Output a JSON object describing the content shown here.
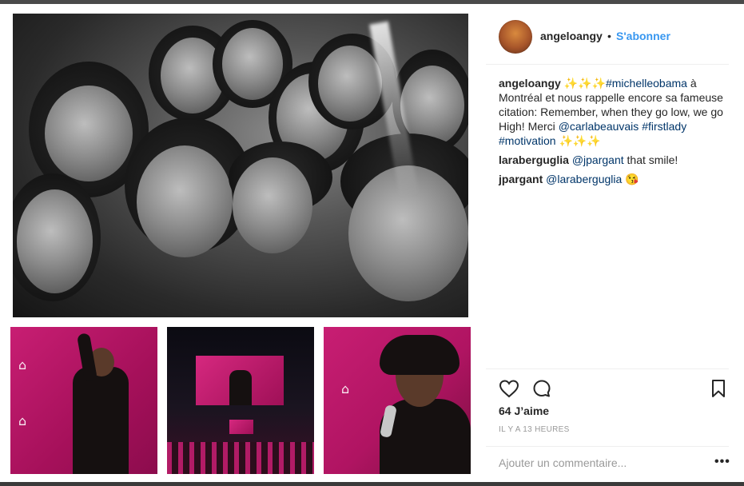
{
  "post": {
    "username": "angeloangy",
    "follow_label": "S'abonner",
    "separator": "•"
  },
  "caption": {
    "username": "angeloangy",
    "sparkles_prefix": "✨✨✨",
    "hashtag_1": "#michelleobama",
    "text_1": " à Montréal et nous rappelle encore sa fameuse citation: Remember, when they go low, we go High! Merci ",
    "mention_1": "@carlabeauvais",
    "hashtag_2": "#firstlady",
    "hashtag_3": "#motivation",
    "sparkles_suffix": "✨✨✨"
  },
  "comments": [
    {
      "username": "laraberguglia",
      "mention": "@jpargant",
      "text": " that smile!"
    },
    {
      "username": "jpargant",
      "mention": "@laraberguglia",
      "emoji": "😘"
    }
  ],
  "actions": {
    "likes_text": "64 J’aime",
    "time_text": "IL Y A 13 HEURES",
    "add_comment_placeholder": "Ajouter un commentaire...",
    "more_label": "•••"
  },
  "icons": {
    "heart": "heart-icon",
    "comment": "comment-icon",
    "bookmark": "bookmark-icon"
  },
  "colors": {
    "accent_blue": "#3897f0",
    "link_dark_blue": "#003569",
    "pink": "#c81e73"
  }
}
